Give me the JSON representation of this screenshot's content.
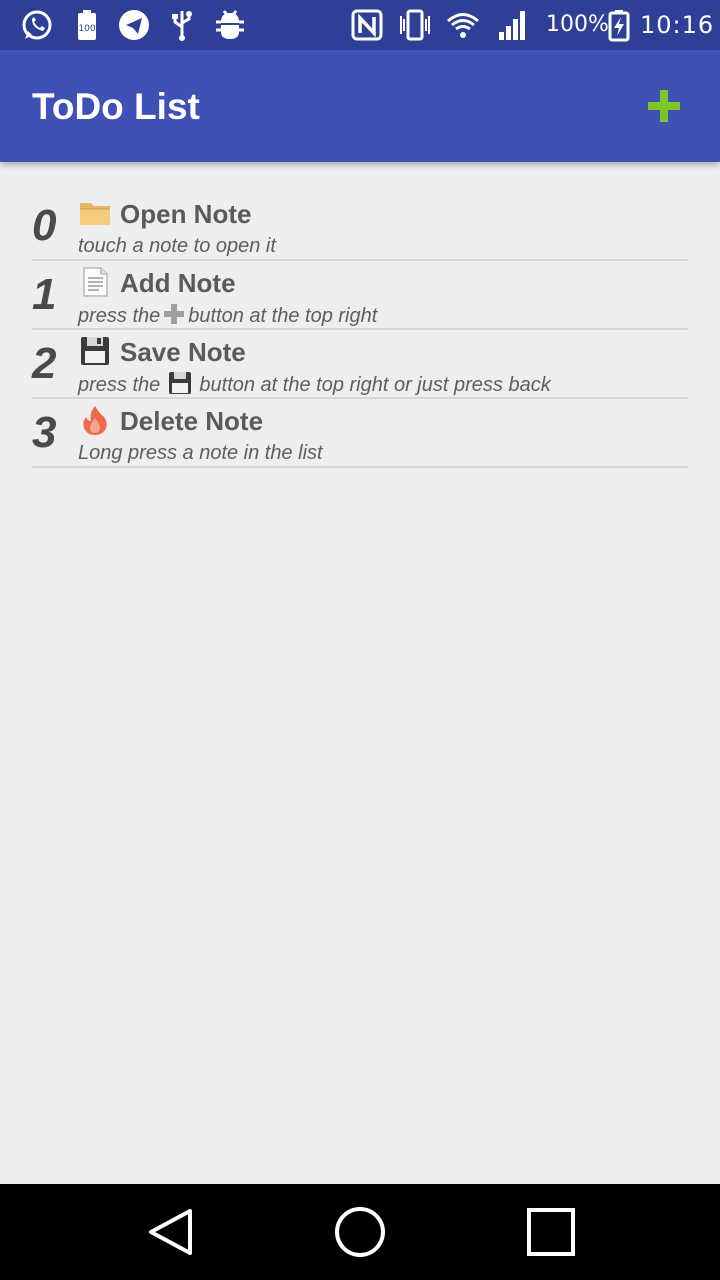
{
  "status_bar": {
    "left_icons": [
      "whatsapp-icon",
      "battery-100-icon",
      "telegram-icon",
      "usb-icon",
      "android-debug-icon"
    ],
    "right_icons": [
      "nfc-icon",
      "vibrate-icon",
      "wifi-icon",
      "signal-icon"
    ],
    "battery_text": "100%",
    "time": "10:16"
  },
  "app_bar": {
    "title": "ToDo List",
    "add_icon": "plus-icon",
    "accent_color": "#7cc62a",
    "background_color": "#3f51b5"
  },
  "notes": [
    {
      "index": "0",
      "icon": "folder-icon",
      "title": "Open Note",
      "desc": "touch a note to open it"
    },
    {
      "index": "1",
      "icon": "page-icon",
      "title": "Add Note",
      "desc_before": "press the",
      "desc_icon": "plus-icon",
      "desc_after": "button at the top right"
    },
    {
      "index": "2",
      "icon": "floppy-disk-icon",
      "title": "Save Note",
      "desc_before": "press the ",
      "desc_icon": "floppy-disk-icon",
      "desc_after": " button at the top right or just press back"
    },
    {
      "index": "3",
      "icon": "fire-icon",
      "title": "Delete Note",
      "desc": "Long press a note in the list"
    }
  ],
  "nav_bar": {
    "back_icon": "back-triangle-icon",
    "home_icon": "home-circle-icon",
    "recents_icon": "recents-square-icon"
  }
}
